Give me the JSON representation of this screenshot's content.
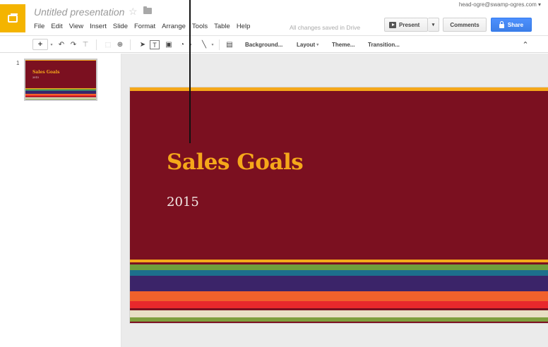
{
  "header": {
    "title": "Untitled presentation",
    "star_glyph": "☆",
    "account": "head-ogre@swamp-ogres.com ▾",
    "save_status": "All changes saved in Drive",
    "present_label": "Present",
    "present_dropdown": "▾",
    "comments_label": "Comments",
    "share_label": "Share"
  },
  "menu": [
    "File",
    "Edit",
    "View",
    "Insert",
    "Slide",
    "Format",
    "Arrange",
    "Tools",
    "Table",
    "Help"
  ],
  "toolbar": {
    "add": "+",
    "undo": "↶",
    "redo": "↷",
    "paint": "⊤",
    "zoom": "⊕",
    "select": "➤",
    "textbox": "T",
    "image": "▣",
    "shape": "◔",
    "line": "╲",
    "comment": "▤",
    "background": "Background...",
    "layout": "Layout",
    "theme": "Theme...",
    "transition": "Transition...",
    "collapse": "⌃"
  },
  "filmstrip": {
    "slide_number": "1",
    "thumb_title": "Sales Goals",
    "thumb_subtitle": "2015"
  },
  "slide": {
    "title": "Sales Goals",
    "subtitle": "2015",
    "background_color": "#7b1020",
    "accent_color": "#f5a81a",
    "stripes": [
      {
        "color": "#f5a81a",
        "height": 4
      },
      {
        "color": "#7b1020",
        "height": 3
      },
      {
        "color": "#6f9e3d",
        "height": 8
      },
      {
        "color": "#1d6f8c",
        "height": 8
      },
      {
        "color": "#3b2469",
        "height": 22
      },
      {
        "color": "#f0612b",
        "height": 14
      },
      {
        "color": "#e8282c",
        "height": 10
      },
      {
        "color": "#7b1020",
        "height": 3
      },
      {
        "color": "#e8dfc4",
        "height": 10
      },
      {
        "color": "#7e9f3e",
        "height": 6
      },
      {
        "color": "#7b1020",
        "height": 2
      }
    ]
  },
  "colors": {
    "logo": "#f4b400",
    "share": "#4d90fe",
    "canvas_bg": "#ebebeb"
  }
}
